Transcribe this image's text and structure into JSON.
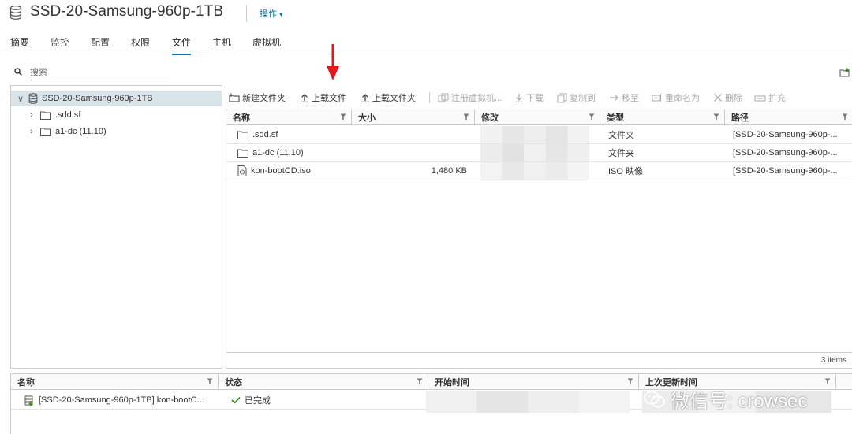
{
  "header": {
    "title": "SSD-20-Samsung-960p-1TB",
    "actions_label": "操作"
  },
  "tabs": [
    {
      "label": "摘要"
    },
    {
      "label": "监控"
    },
    {
      "label": "配置"
    },
    {
      "label": "权限"
    },
    {
      "label": "文件"
    },
    {
      "label": "主机"
    },
    {
      "label": "虚拟机"
    }
  ],
  "active_tab": "文件",
  "search": {
    "placeholder": "搜索",
    "value": ""
  },
  "tree": {
    "root": "SSD-20-Samsung-960p-1TB",
    "children": [
      ".sdd.sf",
      "a1-dc (11.10)"
    ]
  },
  "toolbar": {
    "new_folder": "新建文件夹",
    "upload_file": "上载文件",
    "upload_folder": "上载文件夹",
    "register_vm": "注册虚拟机...",
    "download": "下载",
    "copy_to": "复制到",
    "move_to": "移至",
    "rename": "重命名为",
    "delete": "删除",
    "inflate": "扩充"
  },
  "grid": {
    "columns": {
      "name": "名称",
      "size": "大小",
      "modified": "修改",
      "type": "类型",
      "path": "路径"
    },
    "rows": [
      {
        "name": ".sdd.sf",
        "size": "",
        "type": "文件夹",
        "path": "[SSD-20-Samsung-960p-...",
        "icon": "folder-icon"
      },
      {
        "name": "a1-dc (11.10)",
        "size": "",
        "type": "文件夹",
        "path": "[SSD-20-Samsung-960p-...",
        "icon": "folder-icon"
      },
      {
        "name": "kon-bootCD.iso",
        "size": "1,480 KB",
        "type": "ISO 映像",
        "path": "[SSD-20-Samsung-960p-...",
        "icon": "iso-file-icon"
      }
    ],
    "footer": "3 items"
  },
  "tasks": {
    "columns": {
      "name": "名称",
      "status": "状态",
      "start": "开始时间",
      "last_updated": "上次更新时间"
    },
    "rows": [
      {
        "name": "[SSD-20-Samsung-960p-1TB] kon-bootC...",
        "status": "已完成"
      }
    ]
  },
  "watermark": "微信号: crowsec",
  "colors": {
    "accent": "#0072a3",
    "selected_row": "#d9e4ea",
    "arrow": "#e3161b",
    "success": "#2f8400"
  }
}
